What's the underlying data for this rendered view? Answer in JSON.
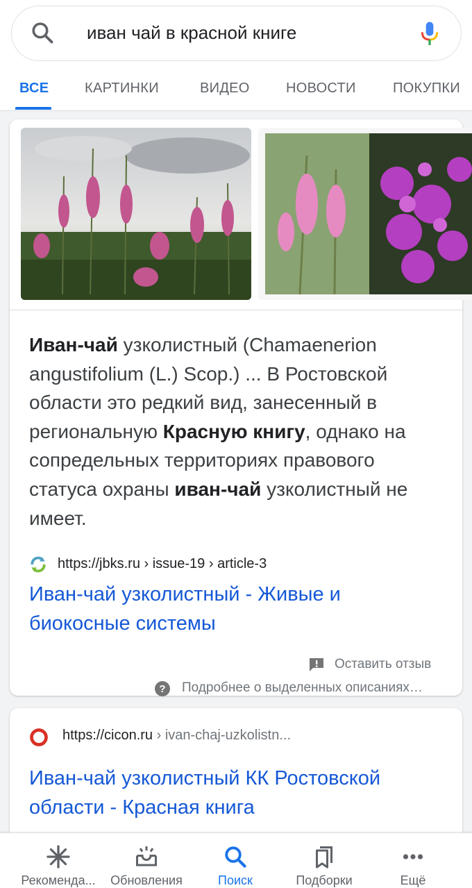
{
  "search": {
    "query": "иван чай в красной книге"
  },
  "tabs": [
    {
      "label": "ВСЕ"
    },
    {
      "label": "КАРТИНКИ"
    },
    {
      "label": "ВИДЕО"
    },
    {
      "label": "НОВОСТИ"
    },
    {
      "label": "ПОКУПКИ"
    }
  ],
  "featured": {
    "snippet": {
      "t1": "Иван-чай",
      "t2": " узколистный (Chamaenerion angustifolium (L.) Scop.) ... В Ростовской области это редкий вид, занесенный в региональную ",
      "t3": "Красную книгу",
      "t4": ", однако на сопредельных территориях правового статуса охраны ",
      "t5": "иван-чай",
      "t6": " узколистный не имеет."
    },
    "source_url": "https://jbks.ru › issue-19 › article-3",
    "title": "Иван-чай узколистный - Живые и биокосные системы",
    "feedback_label": "Оставить отзыв",
    "about_label": "Подробнее о выделенных описаниях…"
  },
  "result2": {
    "url_domain": "https://cicon.ru",
    "url_path": " › ivan-chaj-uzkolistn...",
    "title": "Иван-чай узколистный КК Ростовской области - Красная книга"
  },
  "bottom_nav": [
    {
      "label": "Рекоменда..."
    },
    {
      "label": "Обновления"
    },
    {
      "label": "Поиск"
    },
    {
      "label": "Подборки"
    },
    {
      "label": "Ещё"
    }
  ],
  "colors": {
    "accent": "#1a73e8",
    "link": "#1558d6",
    "text": "#202124",
    "secondary": "#70757a"
  }
}
